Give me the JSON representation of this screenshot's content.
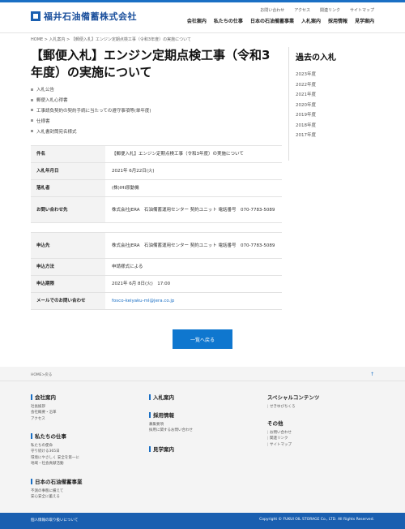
{
  "header": {
    "logo_text": "福井石油備蓄株式会社",
    "utility_links": [
      "お問い合わせ",
      "アクセス",
      "関連リンク",
      "サイトマップ"
    ],
    "nav": [
      "会社案内",
      "私たちの仕事",
      "日本の石油備蓄事業",
      "入札案内",
      "採用情報",
      "見学案内"
    ]
  },
  "breadcrumb": "HOME > 入札案内 > 【郵便入札】エンジン定期点検工事（令和3年度）の実施について",
  "page_title": "【郵便入札】エンジン定期点検工事（令和3年度）の実施について",
  "documents": [
    "入札公告",
    "郵便入札心得書",
    "工事請負契約の契約手続に当たっての遵守事項等(単年度)",
    "仕様書",
    "入札書封筒宛名様式"
  ],
  "sidebar": {
    "title": "過去の入札",
    "years": [
      "2023年度",
      "2022年度",
      "2021年度",
      "2020年度",
      "2019年度",
      "2018年度",
      "2017年度"
    ]
  },
  "table1": [
    {
      "label": "件名",
      "value": "【郵便入札】エンジン定期点検工事（令和3年度）の実施について"
    },
    {
      "label": "入札年月日",
      "value": "2021年 6月22日(火)"
    },
    {
      "label": "落札者",
      "value": "(株)IHI原動機"
    },
    {
      "label": "お問い合わせ先",
      "value": "株式会社JERA　石油備蓄運用センター 契約ユニット 電話番号　070-7783-5089"
    }
  ],
  "table2": [
    {
      "label": "申込先",
      "value": "株式会社JERA　石油備蓄運用センター 契約ユニット 電話番号　070-7783-5089"
    },
    {
      "label": "申込方法",
      "value": "申請様式による"
    },
    {
      "label": "申込期限",
      "value": "2021年 6月 8日(火)　17:00"
    },
    {
      "label": "メールでのお問い合わせ",
      "value": "fosco-keiyaku-ml@jera.co.jp"
    }
  ],
  "back_button": "一覧へ戻る",
  "footer": {
    "crumb": "HOME>戻る",
    "pagetop": "↑",
    "col1": [
      {
        "heading": "会社案内",
        "links": [
          "社長挨拶",
          "会社概要・沿革",
          "アクセス"
        ]
      },
      {
        "heading": "私たちの仕事",
        "links": [
          "私たちの使命",
          "守り続ける365日",
          "環境にやさしく 安全を第一に",
          "地域・社会貢献活動"
        ]
      },
      {
        "heading": "日本の石油備蓄事業",
        "links": [
          "不測の事態に備えて",
          "安心安全に蓄える"
        ]
      }
    ],
    "col2": [
      {
        "heading": "入札案内",
        "links": []
      },
      {
        "heading": "採用情報",
        "links": [
          "募集要項",
          "採用に関するお問い合わせ"
        ]
      },
      {
        "heading": "見学案内",
        "links": []
      }
    ],
    "col3": [
      {
        "heading": "スペシャルコンテンツ",
        "links": [
          "せきゆびちくろ"
        ]
      },
      {
        "heading": "その他",
        "links": [
          "お問い合わせ",
          "関連リンク",
          "サイトマップ"
        ]
      }
    ],
    "privacy": "個人情報の取り扱いについて",
    "copyright": "Copyright © FUKUI OIL STORAGE Co., LTD. All Rights Reserved."
  }
}
